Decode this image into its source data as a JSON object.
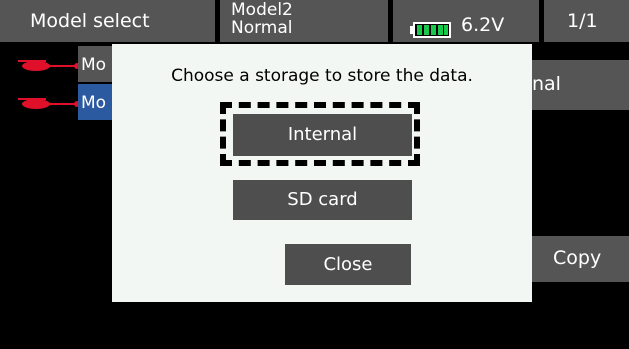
{
  "header": {
    "title": "Model select",
    "model_name": "Model2",
    "model_mode": "Normal",
    "battery_voltage": "6.2V",
    "page_indicator": "1/1"
  },
  "model_list": {
    "items": [
      {
        "label": "Mo",
        "icon": "helicopter-icon",
        "selected": false
      },
      {
        "label": "Mo",
        "icon": "helicopter-icon",
        "selected": true
      }
    ]
  },
  "background_buttons": {
    "top_right_label": "nal",
    "copy_label": "Copy"
  },
  "dialog": {
    "message": "Choose a storage to store the data.",
    "options": {
      "internal": "Internal",
      "sd_card": "SD card"
    },
    "close_label": "Close"
  },
  "colors": {
    "header_cell": "#555555",
    "selected_row": "#2c5aa0",
    "dialog_bg": "#f2f7f3",
    "button_bg": "#4e4e4e",
    "battery_green": "#19c94b",
    "heli_red": "#e0102a"
  }
}
